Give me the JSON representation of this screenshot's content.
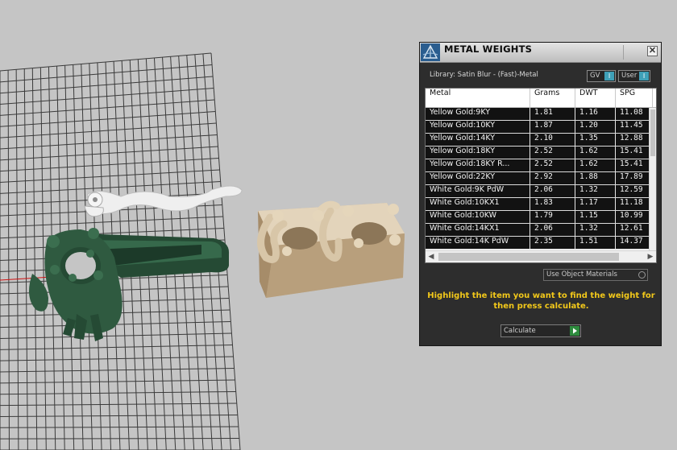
{
  "window": {
    "title": "METAL WEIGHTS",
    "close_glyph": "✕",
    "logo_icon": "pyramid-logo-icon"
  },
  "library_label": "Library: Satin Blur - (Fast)-Metal",
  "toggles": {
    "gv_label": "GV",
    "user_label": "User",
    "knob_glyph": "I"
  },
  "table": {
    "headers": [
      "Metal",
      "Grams",
      "DWT",
      "SPG"
    ],
    "rows": [
      [
        "Yellow Gold:9KY",
        "1.81",
        "1.16",
        "11.08"
      ],
      [
        "Yellow Gold:10KY",
        "1.87",
        "1.20",
        "11.45"
      ],
      [
        "Yellow Gold:14KY",
        "2.10",
        "1.35",
        "12.88"
      ],
      [
        "Yellow Gold:18KY",
        "2.52",
        "1.62",
        "15.41"
      ],
      [
        "Yellow Gold:18KY R...",
        "2.52",
        "1.62",
        "15.41"
      ],
      [
        "Yellow Gold:22KY",
        "2.92",
        "1.88",
        "17.89"
      ],
      [
        "White Gold:9K PdW",
        "2.06",
        "1.32",
        "12.59"
      ],
      [
        "White Gold:10KX1",
        "1.83",
        "1.17",
        "11.18"
      ],
      [
        "White Gold:10KW",
        "1.79",
        "1.15",
        "10.99"
      ],
      [
        "White Gold:14KX1",
        "2.06",
        "1.32",
        "12.61"
      ],
      [
        "White Gold:14K PdW",
        "2.35",
        "1.51",
        "14.37"
      ]
    ]
  },
  "use_object_materials_label": "Use Object Materials",
  "hint_text": "Highlight the item you want to find the weight for then press calculate.",
  "calculate_label": "Calculate",
  "colors": {
    "panel_bg": "#2d2d2d",
    "hint": "#f2c81a",
    "selected_row_bg": "#121212",
    "toggle_knob": "#3fa0b8",
    "go_button": "#2e8b3e",
    "viewport_bg": "#c5c5c5",
    "jewelry_green": "#2f5a40",
    "jewelry_cream": "#d9c8ab",
    "jewelry_white": "#efefef"
  }
}
